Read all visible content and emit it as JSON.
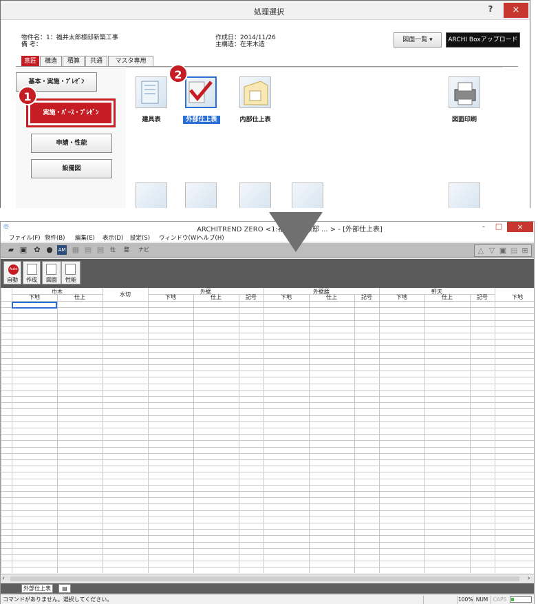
{
  "dialog": {
    "title": "処理選択",
    "help": "?",
    "close": "×",
    "property_name": "物件名：1：福井太郎様邸新築工事",
    "remarks": "備 考：",
    "created": "作成日：2014/11/26",
    "structure": "主構造：在来木造",
    "drawing_list_btn": "図面一覧",
    "archi_upload_btn": "ARCHI Boxアップロード",
    "tabs": [
      "意匠",
      "構造",
      "積算",
      "共通",
      "マスタ専用"
    ],
    "side_buttons": [
      "基本・実施・ﾌﾟﾚｾﾞﾝ",
      "実施・ﾊﾟｰｽ・ﾌﾟﾚｾﾞﾝ",
      "申請・性能",
      "設備図"
    ],
    "items": [
      "建具表",
      "外部仕上表",
      "内部仕上表",
      "図面印刷"
    ],
    "callouts": [
      "1",
      "2"
    ]
  },
  "app": {
    "title": "ARCHITREND ZERO <1:福井太郎様邸 ... > - [外部仕上表]",
    "min": "-",
    "max": "□",
    "close": "×",
    "menus": [
      "ファイル(F)",
      "物件(B)",
      "編集(E)",
      "表示(D)",
      "設定(S)",
      "ウィンドウ(W)",
      "ヘルプ(H)"
    ],
    "toolbar_text": [
      "仕",
      "整",
      "ナビ"
    ],
    "big_buttons": [
      "自動",
      "作成",
      "図面",
      "性能"
    ],
    "auto_badge": "Auto",
    "header_groups": [
      "巾木",
      "水切",
      "外壁",
      "外壁腰",
      "軒天"
    ],
    "header_subs": [
      "下地",
      "仕上",
      "下地",
      "仕上",
      "記号",
      "下地",
      "仕上",
      "記号",
      "下地",
      "仕上",
      "記号",
      "下地"
    ],
    "sheet_tab": "外部仕上表",
    "status_text": "コマンドがありません。選択してください。",
    "status_cells": [
      "100%",
      "NUM",
      "CAPS"
    ]
  },
  "colors": {
    "accent_red": "#c51d23",
    "select_blue": "#2a6fd6"
  }
}
